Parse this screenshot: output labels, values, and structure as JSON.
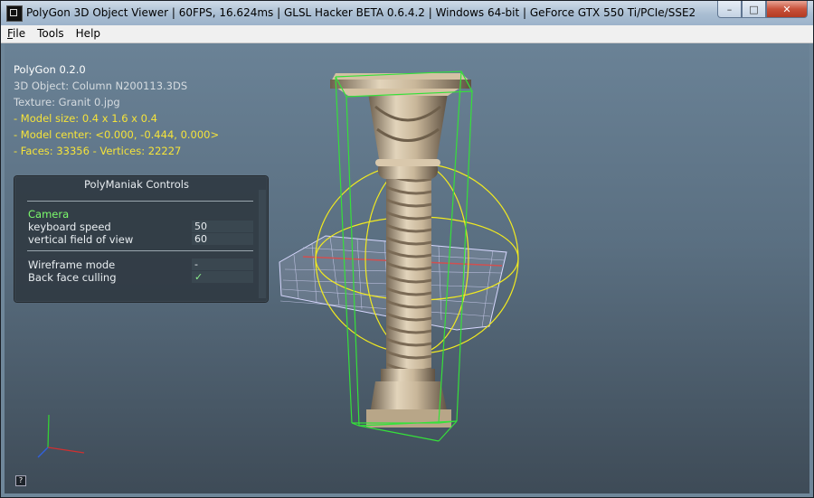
{
  "window": {
    "title": "PolyGon 3D Object Viewer | 60FPS, 16.624ms | GLSL Hacker BETA 0.6.4.2 | Windows 64-bit | GeForce GTX 550 Ti/PCIe/SSE2",
    "controls": {
      "minimize": "–",
      "maximize": "□",
      "close": "✕"
    }
  },
  "menu": {
    "items": [
      {
        "underline": "F",
        "rest": "ile"
      },
      {
        "underline": "",
        "rest": "Tools"
      },
      {
        "underline": "",
        "rest": "Help"
      }
    ]
  },
  "info": {
    "app_version": "PolyGon 0.2.0",
    "object": "3D Object: Column N200113.3DS",
    "texture": "Texture: Granit 0.jpg",
    "model_size": "- Model size:  0.4 x 1.6 x 0.4",
    "model_center": "- Model center:  <0.000, -0.444, 0.000>",
    "faces_vertices": "- Faces: 33356 - Vertices: 22227"
  },
  "panel": {
    "title": "PolyManiak Controls",
    "section": "Camera",
    "keyboard_speed_label": "keyboard speed",
    "keyboard_speed_value": "50",
    "fov_label": "vertical field of view",
    "fov_value": "60",
    "wireframe_label": "Wireframe mode",
    "wireframe_value": "-",
    "backface_label": "Back face culling",
    "backface_value": "✓"
  },
  "help_button": "?",
  "colors": {
    "info_yellow": "#f5e33a",
    "camera_green": "#7cfc6c",
    "bbox_green": "#35e03a",
    "gizmo_yellow": "#f2ea1f"
  }
}
